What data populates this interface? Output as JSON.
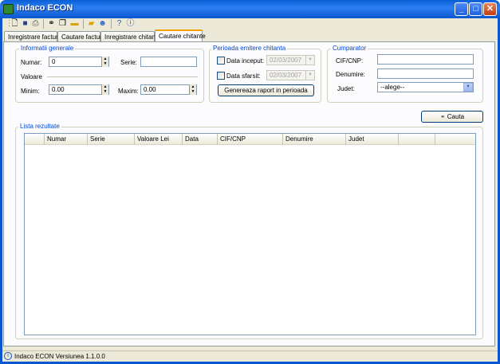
{
  "window": {
    "title": "Indaco ECON"
  },
  "toolbar": {
    "icons": [
      "new-document-icon",
      "save-icon",
      "print-icon",
      "binoculars-icon",
      "copy-icon",
      "folder-icon",
      "open-folder-icon",
      "users-icon",
      "help-icon",
      "info-icon"
    ]
  },
  "tabs": [
    {
      "label": "Inregistrare factura"
    },
    {
      "label": "Cautare facturi"
    },
    {
      "label": "Inregistrare chitanta"
    },
    {
      "label": "Cautare chitante"
    }
  ],
  "general": {
    "title": "Informatii generale",
    "numar_label": "Numar:",
    "numar_value": "0",
    "serie_label": "Serie:",
    "serie_value": "",
    "valoare_label": "Valoare",
    "minim_label": "Minim:",
    "minim_value": "0.00",
    "maxim_label": "Maxim:",
    "maxim_value": "0.00"
  },
  "period": {
    "title": "Perioada emitere chitanta",
    "start_label": "Data inceput:",
    "start_value": "02/03/2007",
    "end_label": "Data sfarsit:",
    "end_value": "02/03/2007",
    "report_button": "Genereaza raport in perioada"
  },
  "buyer": {
    "title": "Cumparator",
    "cif_label": "CIF/CNP:",
    "denumire_label": "Denumire:",
    "judet_label": "Judet:",
    "judet_value": "--alege--"
  },
  "search_button": "Cauta",
  "results": {
    "title": "Lista rezultate",
    "columns": [
      "Numar",
      "Serie",
      "Valoare Lei",
      "Data",
      "CIF/CNP",
      "Denumire",
      "Judet"
    ]
  },
  "status": {
    "text": "Indaco ECON Versiunea 1.1.0.0"
  },
  "colors": {
    "title_bar": "#0a56d0",
    "group_title": "#0046d5",
    "face": "#ece9d8"
  }
}
